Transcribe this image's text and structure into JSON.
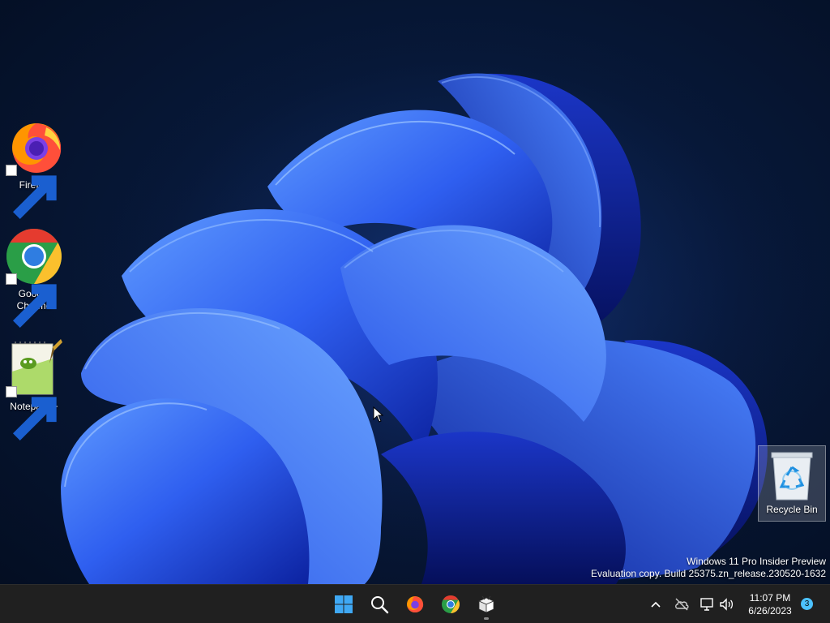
{
  "desktop": {
    "icons": [
      {
        "label": "Firefox",
        "icon": "firefox-icon"
      },
      {
        "label": "Google\nChrome",
        "icon": "chrome-icon"
      },
      {
        "label": "Notepad++",
        "icon": "notepadpp-icon"
      }
    ],
    "recycle_bin": {
      "label": "Recycle Bin",
      "icon": "recycle-bin-icon"
    },
    "watermark": {
      "line1": "Windows 11 Pro Insider Preview",
      "line2": "Evaluation copy. Build 25375.zn_release.230520-1632"
    }
  },
  "taskbar": {
    "apps": [
      {
        "name": "Start",
        "icon": "windows-start-icon"
      },
      {
        "name": "Search",
        "icon": "search-icon"
      },
      {
        "name": "Firefox",
        "icon": "firefox-icon"
      },
      {
        "name": "Google Chrome",
        "icon": "chrome-icon"
      },
      {
        "name": "Package",
        "icon": "package-icon",
        "running": true
      }
    ],
    "tray": {
      "icons": [
        "chevron-up-icon",
        "cloud-offline-icon",
        "network-icon",
        "volume-icon"
      ],
      "time": "11:07 PM",
      "date": "6/26/2023",
      "notification_count": "3"
    }
  },
  "colors": {
    "taskbar_bg": "#202020",
    "accent": "#4cc2ff",
    "wallpaper_bloom": "#1f4fe0"
  }
}
